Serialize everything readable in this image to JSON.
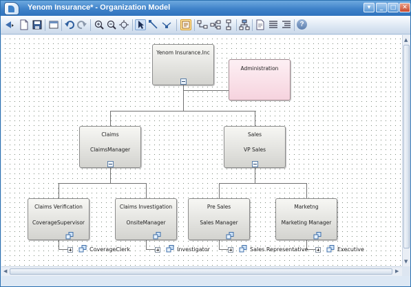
{
  "window": {
    "title": "Yenom Insurance* - Organization Model",
    "controls": [
      "▾",
      "_",
      "□",
      "✕"
    ]
  },
  "toolbar": {
    "buttons": [
      "navigate-icon",
      "new-icon",
      "save-icon",
      "layout-icon",
      "undo-icon",
      "redo-icon",
      "zoom-in-icon",
      "zoom-out-icon",
      "fit-icon",
      "pointer-icon",
      "connector-icon",
      "connector-multi-icon",
      "properties-icon",
      "tree-layout-icon",
      "tree-layout-2-icon",
      "tree-layout-3-icon",
      "org-layout-icon",
      "document-icon",
      "list-icon",
      "list-2-icon",
      "help-icon"
    ],
    "help_label": "?"
  },
  "diagram": {
    "root": {
      "title": "Yenom Insurance.Inc"
    },
    "admin": {
      "title": "Administration"
    },
    "claims": {
      "title": "Claims",
      "manager": "ClaimsManager"
    },
    "sales": {
      "title": "Sales",
      "manager": "VP Sales"
    },
    "units": [
      {
        "title": "Claims Verification",
        "position": "CoverageSupervisor",
        "role": "CoverageClerk"
      },
      {
        "title": "Claims Investigation",
        "position": "OnsiteManager",
        "role": "Investigator"
      },
      {
        "title": "Pre Sales",
        "position": "Sales Manager",
        "role": "Sales Representative"
      },
      {
        "title": "Marketng",
        "position": "Marketing Manager",
        "role": "Executive"
      }
    ]
  },
  "scrollbars": {
    "up": "▲",
    "down": "▼",
    "left": "◀",
    "right": "▶"
  }
}
